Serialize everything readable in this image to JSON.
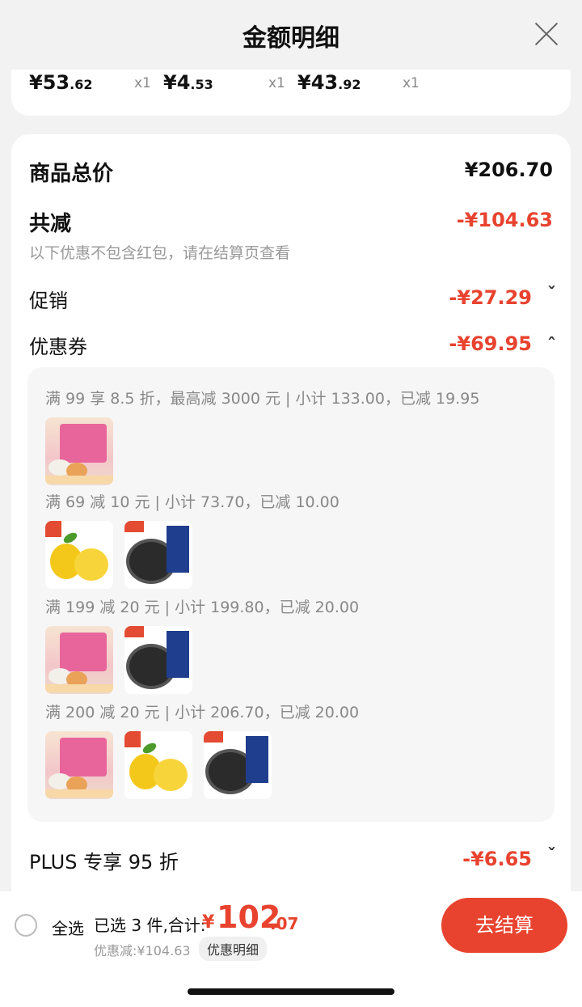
{
  "header": {
    "title": "金额明细",
    "close_icon": "close-icon"
  },
  "items": [
    {
      "price_int": "¥53",
      "price_dec": ".62",
      "qty": "x1"
    },
    {
      "price_int": "¥4",
      "price_dec": ".53",
      "qty": "x1"
    },
    {
      "price_int": "¥43",
      "price_dec": ".92",
      "qty": "x1"
    }
  ],
  "summary": {
    "total_label": "商品总价",
    "total_value": "¥206.70",
    "discount_label": "共减",
    "discount_value": "-¥104.63",
    "note": "以下优惠不包含红包，请在结算页查看",
    "promo_label": "促销",
    "promo_value": "-¥27.29",
    "coupon_label": "优惠券",
    "coupon_value": "-¥69.95",
    "plus_label": "PLUS 专享 95 折",
    "plus_value": "-¥6.65"
  },
  "coupon_rules": [
    {
      "text": "满 99 享 8.5 折，最高减 3000 元 | 小计 133.00，已减 19.95",
      "thumbs": [
        "mooncake-gift-box"
      ]
    },
    {
      "text": "满 69 减 10 元 | 小计 73.70，已减 10.00",
      "thumbs": [
        "lemon",
        "shrimp"
      ]
    },
    {
      "text": "满 199 减 20 元 | 小计 199.80，已减 20.00",
      "thumbs": [
        "mooncake-gift-box",
        "shrimp"
      ]
    },
    {
      "text": "满 200 减 20 元 | 小计 206.70，已减 20.00",
      "thumbs": [
        "mooncake-gift-box",
        "lemon",
        "shrimp"
      ]
    }
  ],
  "bottom": {
    "select_all": "全选",
    "selected_label": "已选 3 件,合计:",
    "currency": "¥",
    "sum_int": "102",
    "sum_dec": ".07",
    "saved": "优惠减:¥104.63",
    "detail_link": "优惠明细",
    "checkout": "去结算"
  },
  "colors": {
    "accent": "#e8432f",
    "background": "#f2f2f2",
    "muted": "#999999"
  }
}
